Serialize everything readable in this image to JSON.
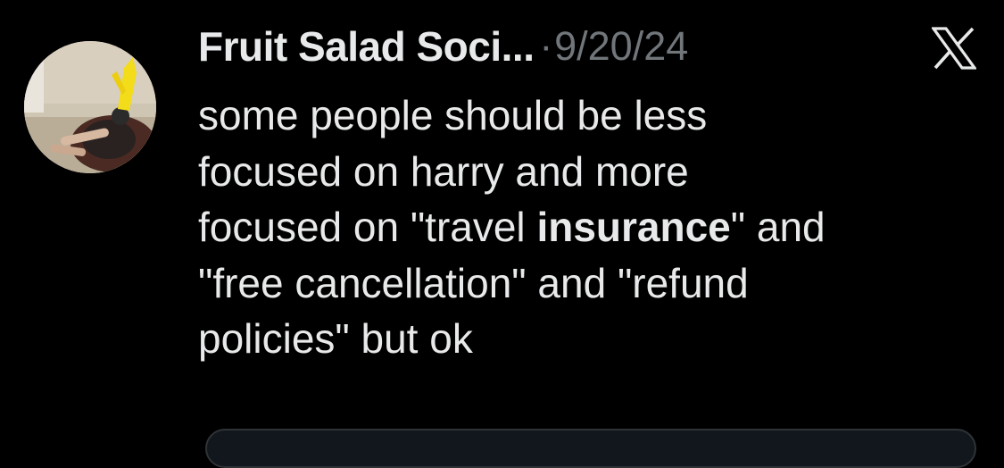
{
  "tweet": {
    "author": {
      "display_name": "Fruit Salad Soci...",
      "avatar_icon": "profile-photo"
    },
    "separator": "·",
    "date": "9/20/24",
    "logo_icon": "x-logo-icon",
    "text_lines": {
      "l1": "some people should be less",
      "l2": "focused on harry and more",
      "l3_pre": "focused on \"travel ",
      "l3_bold": "insurance",
      "l3_post": "\" and",
      "l4": "\"free cancellation\" and \"refund",
      "l5": "policies\" but ok"
    }
  },
  "colors": {
    "background": "#000000",
    "primary_text": "#e7e9ea",
    "secondary_text": "#71767b"
  }
}
